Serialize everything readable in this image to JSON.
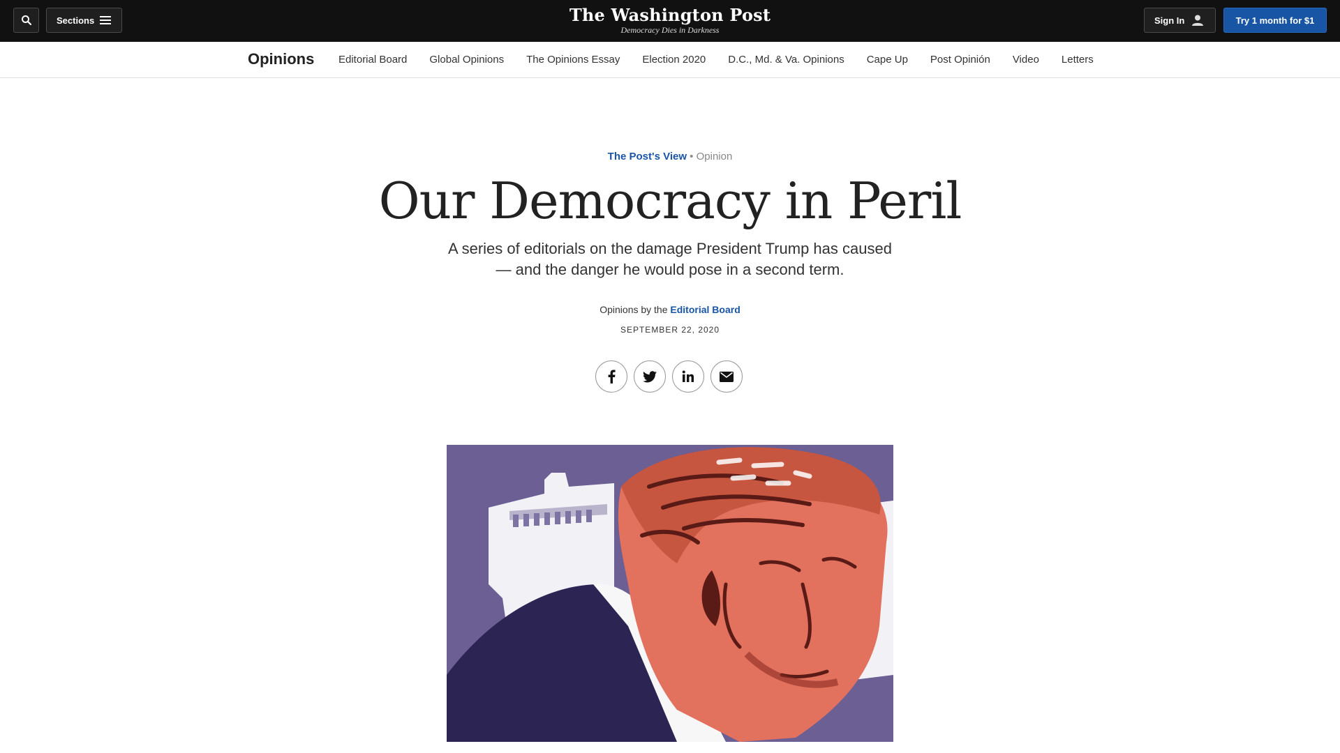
{
  "topbar": {
    "sections_label": "Sections",
    "logo_name": "The Washington Post",
    "logo_tagline": "Democracy Dies in Darkness",
    "signin_label": "Sign In",
    "cta_label": "Try 1 month for $1"
  },
  "subnav": {
    "title": "Opinions",
    "items": [
      {
        "label": "Editorial Board"
      },
      {
        "label": "Global Opinions"
      },
      {
        "label": "The Opinions Essay"
      },
      {
        "label": "Election 2020"
      },
      {
        "label": "D.C., Md. & Va. Opinions"
      },
      {
        "label": "Cape Up"
      },
      {
        "label": "Post Opinión"
      },
      {
        "label": "Video"
      },
      {
        "label": "Letters"
      }
    ]
  },
  "article": {
    "kicker_primary": "The Post's View",
    "kicker_separator": "•",
    "kicker_secondary": "Opinion",
    "headline": "Our Democracy in Peril",
    "dek": "A series of editorials on the damage President Trump has caused — and the danger he would pose in a second term.",
    "byline_prefix": "Opinions by the",
    "byline_author": "Editorial Board",
    "date": "SEPTEMBER 22, 2020"
  },
  "share": [
    "facebook-icon",
    "twitter-icon",
    "linkedin-icon",
    "email-icon"
  ],
  "colors": {
    "topbar_bg": "#111111",
    "accent_blue": "#1955a5",
    "art_bg": "#6b5f93"
  }
}
